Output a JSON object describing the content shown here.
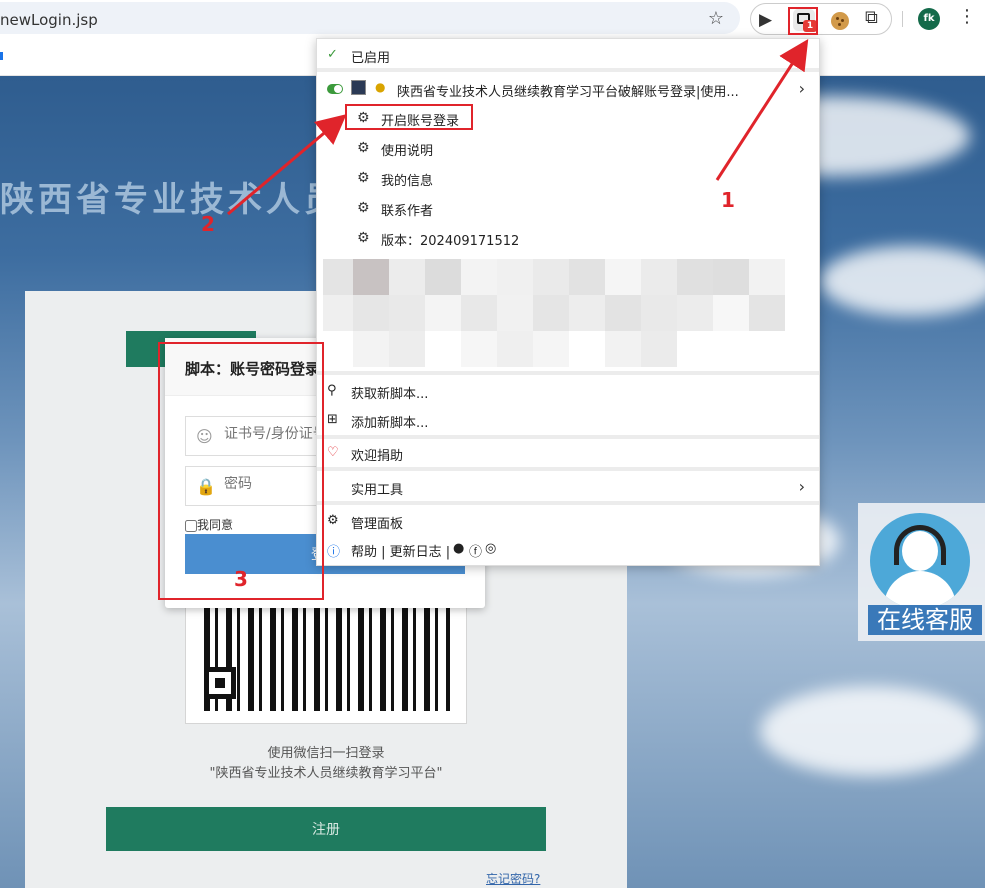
{
  "browser": {
    "url": "newLogin.jsp",
    "star_icon": "star-icon",
    "badge_count": "1",
    "profile_initials": "fk"
  },
  "page": {
    "title_text": "陕西省专业技术人员",
    "register_label": "注册",
    "forgot_label": "忘记密码?",
    "qr_caption_line1": "使用微信扫一扫登录",
    "qr_caption_line2": "\"陕西省专业技术人员继续教育学习平台\"",
    "customer_service_label": "在线客服"
  },
  "dialog": {
    "title": "脚本：账号密码登录",
    "account_placeholder": "证书号/身份证号",
    "password_placeholder": "密码",
    "agree_label": "我同意",
    "submit_label": "登录"
  },
  "menu": {
    "enabled_label": "已启用",
    "script_name": "陕西省专业技术人员继续教育学习平台破解账号登录|使用...",
    "commands": [
      {
        "label": "开启账号登录"
      },
      {
        "label": "使用说明"
      },
      {
        "label": "我的信息"
      },
      {
        "label": "联系作者"
      },
      {
        "label": "版本：202409171512"
      }
    ],
    "get_new_scripts": "获取新脚本...",
    "add_new_script": "添加新脚本...",
    "donate": "欢迎捐助",
    "utilities": "实用工具",
    "dashboard": "管理面板",
    "help_line": "帮助 | 更新日志 |"
  },
  "annotations": {
    "n1": "1",
    "n2": "2",
    "n3": "3",
    "color": "#e0242b"
  },
  "colors": {
    "accent_green": "#1f7b5f",
    "dialog_button": "#4a8ed0",
    "toggle_on": "#3c9a3c"
  }
}
